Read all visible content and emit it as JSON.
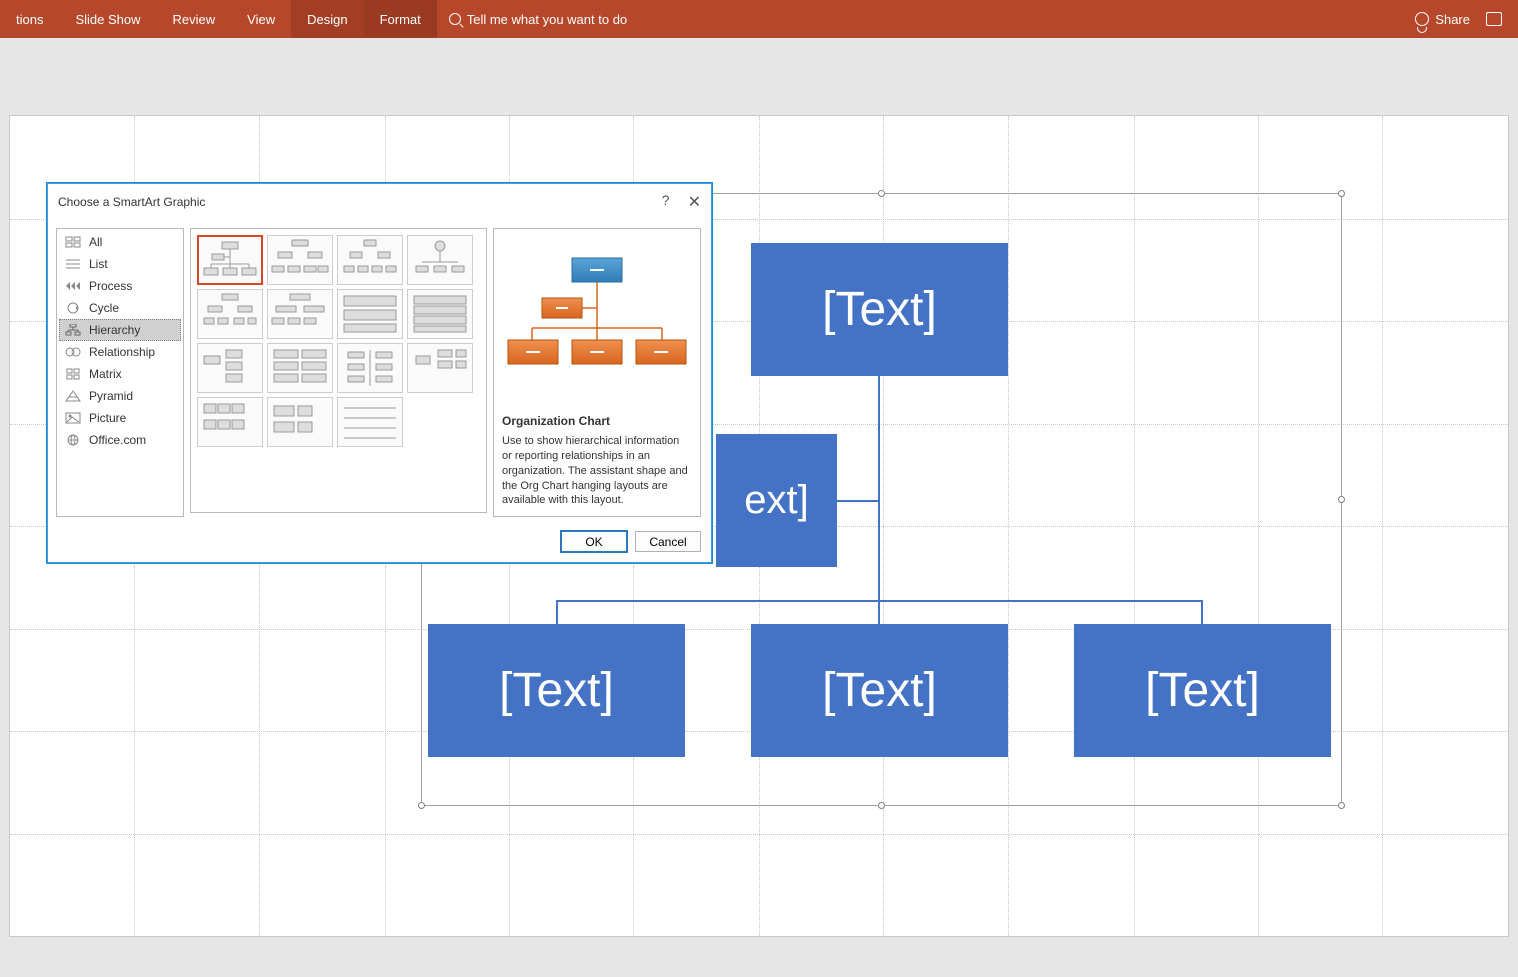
{
  "ribbon": {
    "tabs": [
      "tions",
      "Slide Show",
      "Review",
      "View",
      "Design",
      "Format"
    ],
    "active_tabs": [
      "Design",
      "Format"
    ],
    "tell_me": "Tell me what you want to do",
    "share": "Share"
  },
  "smartart": {
    "boxes": {
      "top": "[Text]",
      "assistant": "ext]",
      "child1": "[Text]",
      "child2": "[Text]",
      "child3": "[Text]"
    }
  },
  "dialog": {
    "title": "Choose a SmartArt Graphic",
    "help": "?",
    "close": "✕",
    "categories": [
      "All",
      "List",
      "Process",
      "Cycle",
      "Hierarchy",
      "Relationship",
      "Matrix",
      "Pyramid",
      "Picture",
      "Office.com"
    ],
    "selected_category": "Hierarchy",
    "preview": {
      "title": "Organization Chart",
      "desc": "Use to show hierarchical information or reporting relationships in an organization. The assistant shape and the Org Chart hanging layouts are available with this layout."
    },
    "buttons": {
      "ok": "OK",
      "cancel": "Cancel"
    }
  }
}
